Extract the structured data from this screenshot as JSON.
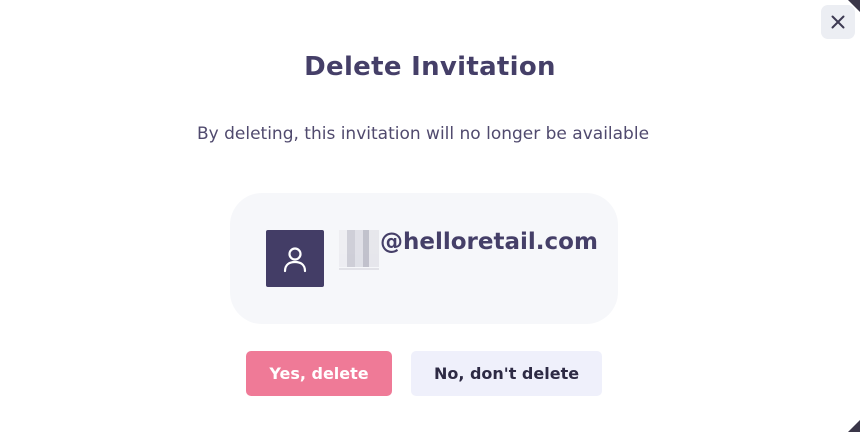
{
  "dialog": {
    "title": "Delete Invitation",
    "message": "By deleting, this invitation will no longer be available",
    "close_icon": "close-icon"
  },
  "invitee": {
    "avatar_icon": "user-icon",
    "email": "@helloretail.com"
  },
  "actions": {
    "confirm_label": "Yes, delete",
    "cancel_label": "No, don't delete"
  },
  "colors": {
    "title": "#453f68",
    "avatar_bg": "#433d66",
    "confirm_bg": "#ef7a97",
    "cancel_bg": "#eff0fb"
  }
}
